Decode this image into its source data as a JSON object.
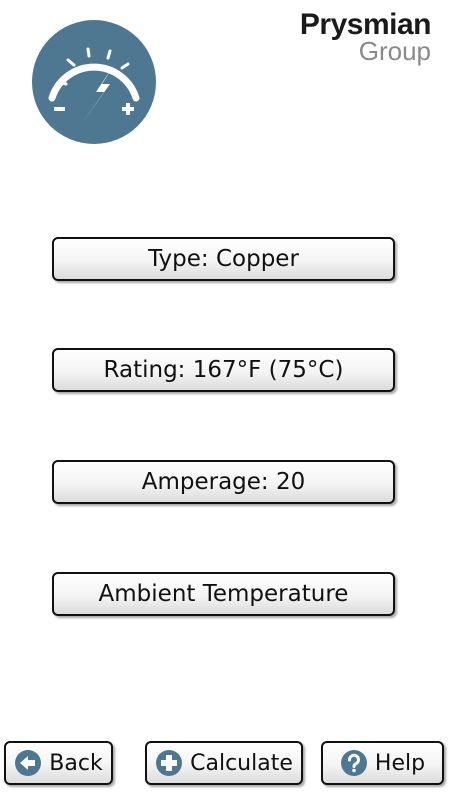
{
  "header": {
    "brand_name": "Prysmian",
    "brand_sub": "Group",
    "logo_icon": "gauge-bolt-icon",
    "logo_color": "#4e7891"
  },
  "options": {
    "type_label": "Type: Copper",
    "rating_label": "Rating: 167°F (75°C)",
    "amperage_label": "Amperage: 20",
    "ambient_label": "Ambient Temperature"
  },
  "footer": {
    "back_label": "Back",
    "back_icon": "arrow-left-circle-icon",
    "calculate_label": "Calculate",
    "calculate_icon": "plus-circle-icon",
    "help_label": "Help",
    "help_icon": "question-circle-icon",
    "icon_color": "#4e7891"
  }
}
